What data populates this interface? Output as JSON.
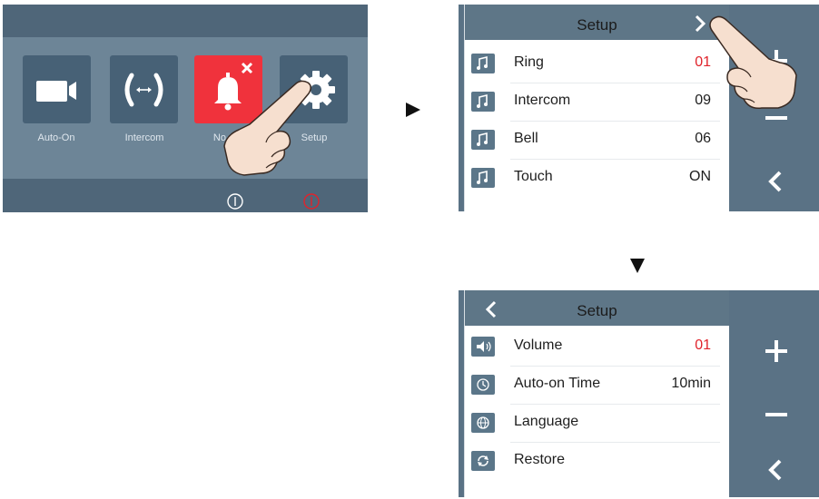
{
  "main_menu": {
    "tiles": [
      {
        "label": "Auto-On",
        "icon": "video-camera-icon"
      },
      {
        "label": "Intercom",
        "icon": "intercom-icon"
      },
      {
        "label": "No dist",
        "icon": "bell-mute-icon"
      },
      {
        "label": "Setup",
        "icon": "gear-icon"
      }
    ],
    "power_icons": [
      "power-icon",
      "power-icon-red"
    ]
  },
  "setup_ringtones": {
    "title": "Setup",
    "rows": [
      {
        "label": "Ring",
        "value": "01",
        "icon": "music-note-icon"
      },
      {
        "label": "Intercom",
        "value": "09",
        "icon": "music-note-icon"
      },
      {
        "label": "Bell",
        "value": "06",
        "icon": "music-note-icon"
      },
      {
        "label": "Touch",
        "value": "ON",
        "icon": "music-note-icon"
      }
    ]
  },
  "setup_general": {
    "title": "Setup",
    "rows": [
      {
        "label": "Volume",
        "value": "01",
        "icon": "speaker-icon"
      },
      {
        "label": "Auto-on Time",
        "value": "10min",
        "icon": "clock-icon"
      },
      {
        "label": "Language",
        "value": "",
        "icon": "globe-icon"
      },
      {
        "label": "Restore",
        "value": "",
        "icon": "restore-icon"
      }
    ]
  },
  "colors": {
    "panel": "#5a7285",
    "accent_red": "#e0232b",
    "alert_tile": "#f0323c"
  }
}
